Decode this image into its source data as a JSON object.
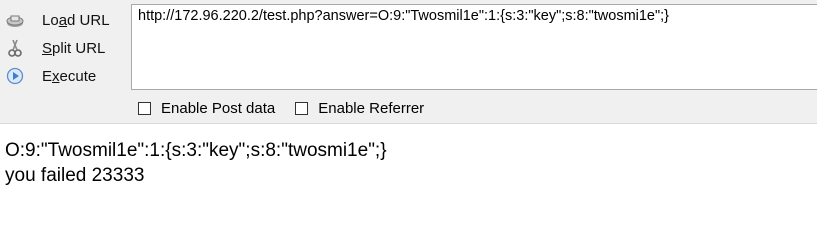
{
  "toolbar": {
    "actions": [
      {
        "label_pre": "Lo",
        "label_acc": "a",
        "label_post": "d URL",
        "icon": "load-url-icon"
      },
      {
        "label_pre": "",
        "label_acc": "S",
        "label_post": "plit URL",
        "icon": "split-url-icon"
      },
      {
        "label_pre": "E",
        "label_acc": "x",
        "label_post": "ecute",
        "icon": "execute-icon"
      }
    ],
    "url_value": "http://172.96.220.2/test.php?answer=O:9:\"Twosmil1e\":1:{s:3:\"key\";s:8:\"twosmi1e\";}",
    "options": [
      {
        "label": "Enable Post data",
        "checked": false
      },
      {
        "label": "Enable Referrer",
        "checked": false
      }
    ]
  },
  "output": {
    "line1": "O:9:\"Twosmil1e\":1:{s:3:\"key\";s:8:\"twosmi1e\";}",
    "line2": "you failed 23333"
  },
  "colors": {
    "toolbar_bg": "#f0f0f0",
    "execute_icon": "#4a90d9"
  }
}
